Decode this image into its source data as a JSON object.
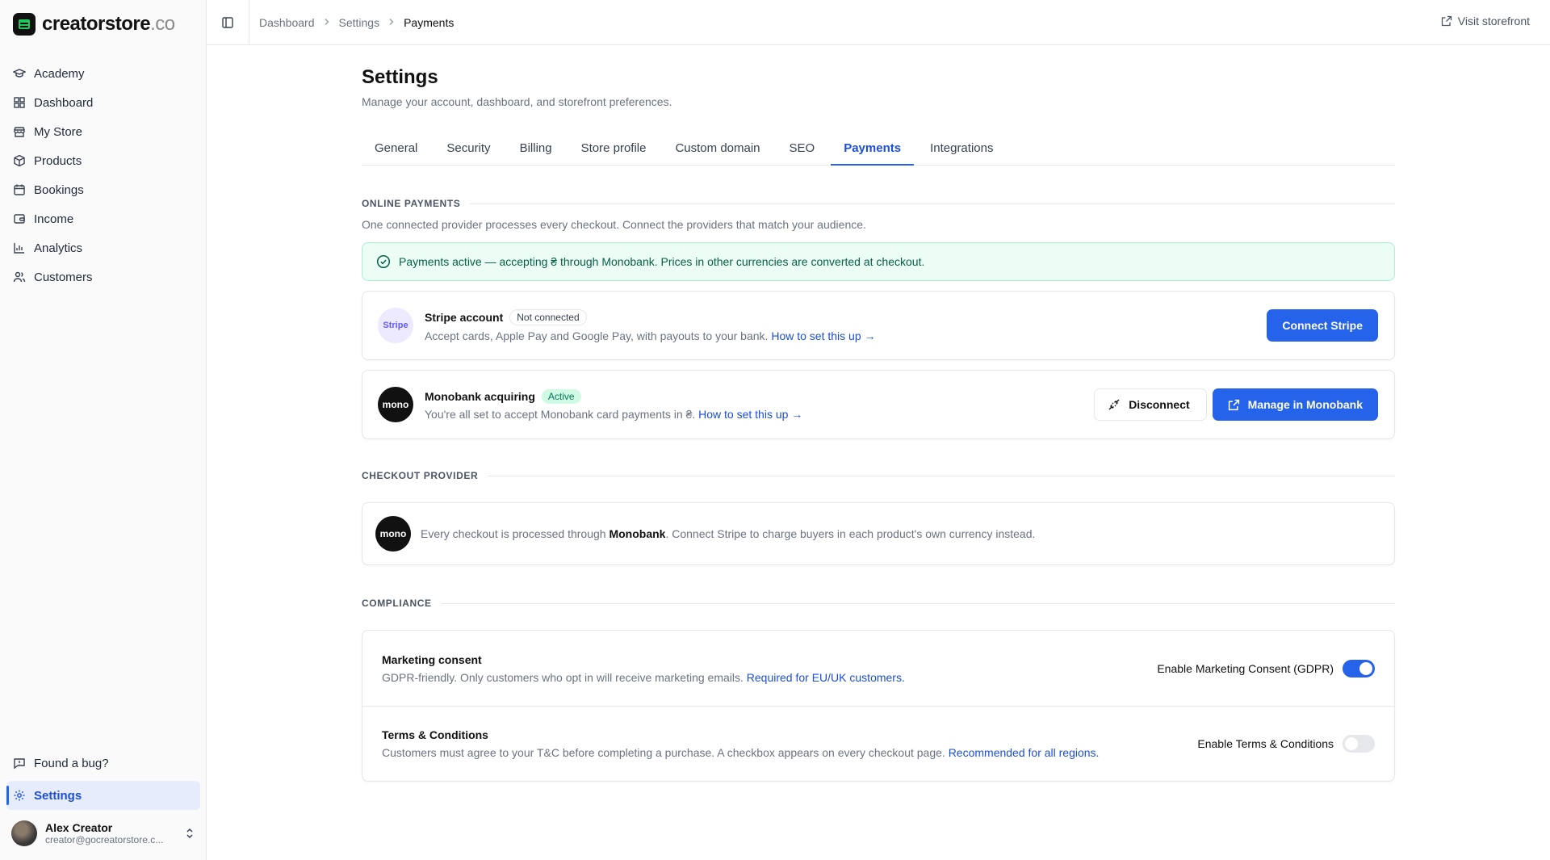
{
  "brand": {
    "name": "creatorstore",
    "tld": ".co"
  },
  "sidebar": {
    "items": [
      {
        "label": "Academy",
        "icon": "graduation-cap-icon"
      },
      {
        "label": "Dashboard",
        "icon": "layout-grid-icon"
      },
      {
        "label": "My Store",
        "icon": "store-icon"
      },
      {
        "label": "Products",
        "icon": "package-icon"
      },
      {
        "label": "Bookings",
        "icon": "calendar-icon"
      },
      {
        "label": "Income",
        "icon": "wallet-icon"
      },
      {
        "label": "Analytics",
        "icon": "bar-chart-icon"
      },
      {
        "label": "Customers",
        "icon": "users-icon"
      }
    ],
    "bug_label": "Found a bug?",
    "settings_label": "Settings"
  },
  "user": {
    "name": "Alex Creator",
    "email": "creator@gocreatorstore.c..."
  },
  "breadcrumb": {
    "items": [
      "Dashboard",
      "Settings",
      "Payments"
    ]
  },
  "header": {
    "visit_label": "Visit storefront"
  },
  "page": {
    "title": "Settings",
    "subtitle": "Manage your account, dashboard, and storefront preferences."
  },
  "tabs": [
    "General",
    "Security",
    "Billing",
    "Store profile",
    "Custom domain",
    "SEO",
    "Payments",
    "Integrations"
  ],
  "active_tab": "Payments",
  "online": {
    "title": "ONLINE PAYMENTS",
    "desc": "One connected provider processes every checkout. Connect the providers that match your audience.",
    "alert": "Payments active — accepting ₴ through Monobank. Prices in other currencies are converted at checkout."
  },
  "stripe": {
    "logo": "Stripe",
    "name": "Stripe account",
    "badge": "Not connected",
    "desc": "Accept cards, Apple Pay and Google Pay, with payouts to your bank.",
    "link": "How to set this up →",
    "button": "Connect Stripe"
  },
  "monobank": {
    "logo": "mono",
    "name": "Monobank acquiring",
    "badge": "Active",
    "desc": "You're all set to accept Monobank card payments in ₴.",
    "link": "How to set this up →",
    "disconnect": "Disconnect",
    "manage": "Manage in Monobank"
  },
  "checkout": {
    "title": "CHECKOUT PROVIDER",
    "logo": "mono",
    "prefix": "Every checkout is processed through",
    "provider": "Monobank",
    "suffix": ". Connect Stripe to charge buyers in each product's own currency instead."
  },
  "compliance": {
    "title": "COMPLIANCE",
    "marketing": {
      "title": "Marketing consent",
      "desc": "GDPR-friendly. Only customers who opt in will receive marketing emails.",
      "link": "Required for EU/UK customers.",
      "toggle_label": "Enable Marketing Consent (GDPR)",
      "enabled": true
    },
    "terms": {
      "title": "Terms & Conditions",
      "desc": "Customers must agree to your T&C before completing a purchase. A checkbox appears on every checkout page.",
      "link": "Recommended for all regions.",
      "toggle_label": "Enable Terms & Conditions",
      "enabled": false
    }
  },
  "colors": {
    "accent": "#2563eb",
    "success_bg": "#ecfdf5",
    "success_text": "#065f46"
  }
}
